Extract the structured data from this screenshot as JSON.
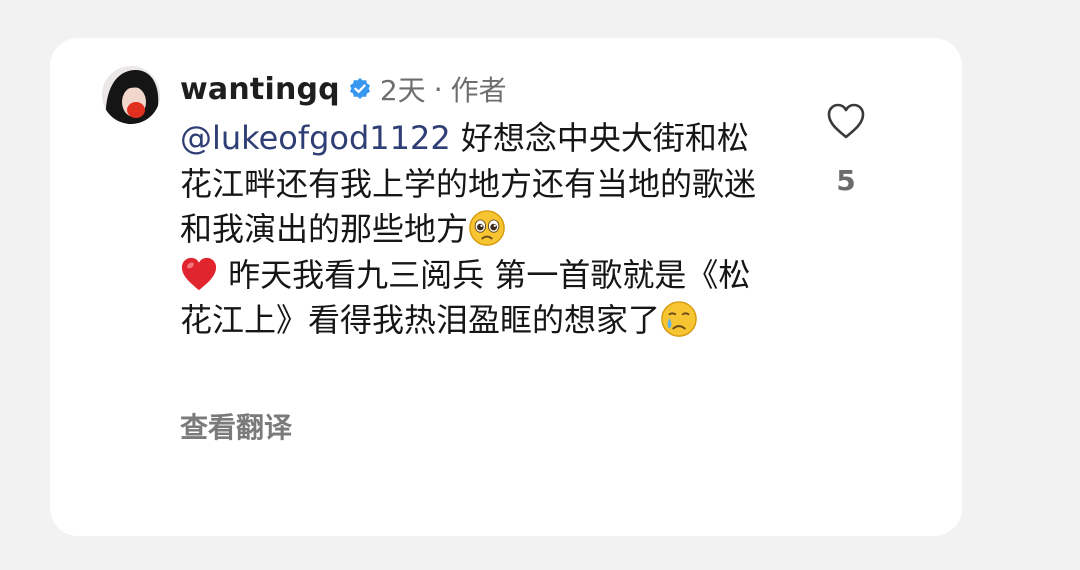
{
  "comment": {
    "username": "wantingq",
    "time": "2天",
    "separator": "·",
    "role": "作者",
    "mention": "@lukeofgod1122",
    "text_part1": " 好想念中央大街和松花江畔还有我上学的地方还有当地的歌迷和我演出的那些地方",
    "text_part2": " 昨天我看九三阅兵 第一首歌就是《松花江上》看得我热泪盈眶的想家了",
    "translate_label": "查看翻译",
    "like_count": "5"
  },
  "icons": {
    "verified": "verified-badge-icon",
    "pleading_emoji": "pleading-face-emoji",
    "heart_emoji": "red-heart-emoji",
    "crying_emoji": "crying-face-emoji",
    "like": "heart-outline-icon"
  },
  "colors": {
    "verified_blue": "#3897f0",
    "mention": "#2f3e74",
    "heart_red": "#e0252f"
  }
}
